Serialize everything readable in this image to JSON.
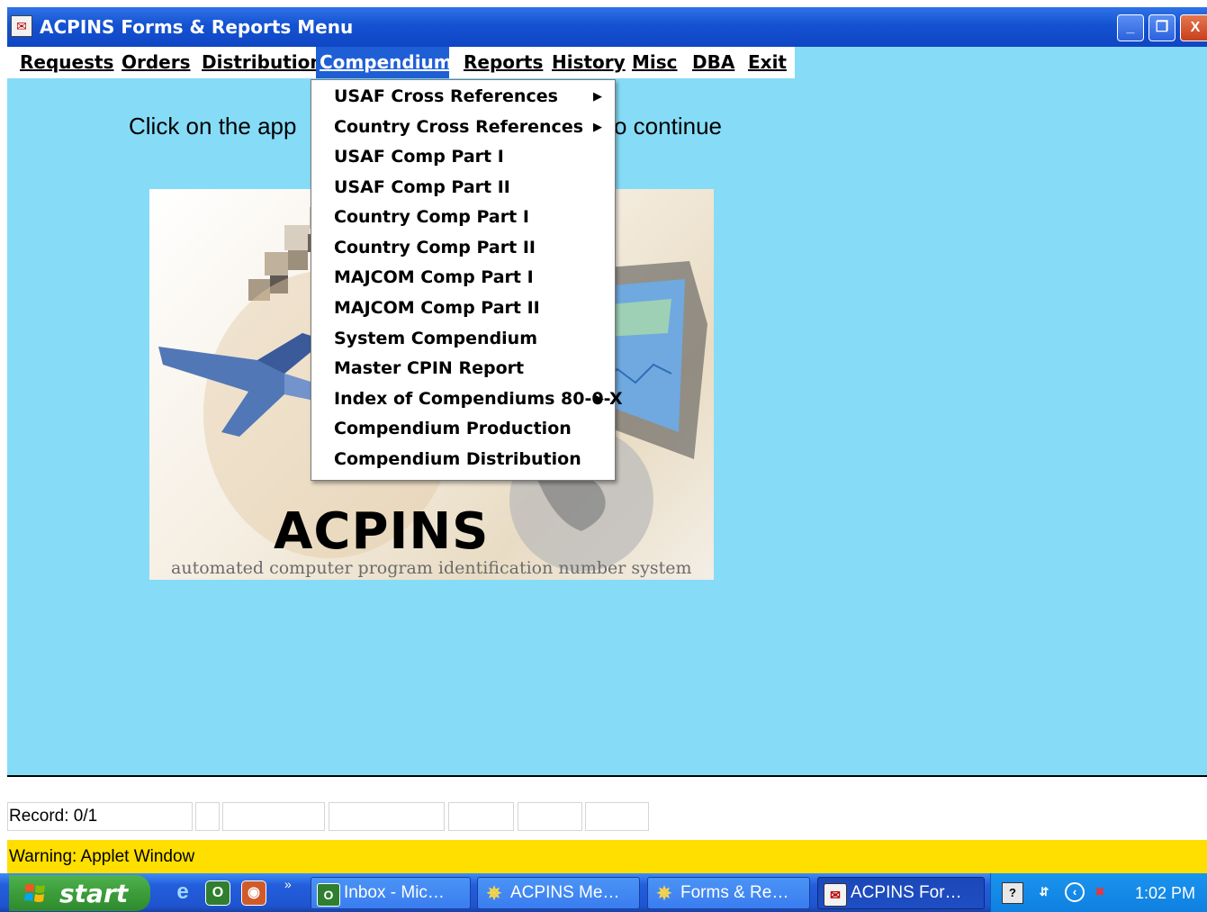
{
  "window": {
    "title": "ACPINS Forms & Reports Menu",
    "controls": {
      "minimize": "_",
      "maximize": "❐",
      "close": "X"
    }
  },
  "menubar": {
    "items": [
      {
        "label": "Requests"
      },
      {
        "label": "Orders"
      },
      {
        "label": "Distribution"
      },
      {
        "label": "Compendiums",
        "active": true
      },
      {
        "label": "Reports"
      },
      {
        "label": "History"
      },
      {
        "label": "Misc"
      },
      {
        "label": "DBA"
      },
      {
        "label": "Exit"
      }
    ]
  },
  "main": {
    "instruction_visible_left": "Click on the app",
    "instruction_visible_right": "o continue"
  },
  "splash": {
    "logo_word": "ACPINS",
    "tagline": "automated computer program identification number system"
  },
  "dropdown": {
    "items": [
      {
        "label": "USAF Cross References",
        "submenu": true
      },
      {
        "label": "Country Cross References",
        "submenu": true
      },
      {
        "label": "USAF Comp Part I"
      },
      {
        "label": "USAF Comp Part II"
      },
      {
        "label": "Country Comp Part I"
      },
      {
        "label": "Country Comp Part II"
      },
      {
        "label": "MAJCOM Comp Part I"
      },
      {
        "label": "MAJCOM Comp Part II"
      },
      {
        "label": "System Compendium"
      },
      {
        "label": "Master CPIN Report"
      },
      {
        "label": "Index of Compendiums 80-0-X",
        "submenu": true
      },
      {
        "label": "Compendium Production"
      },
      {
        "label": "Compendium Distribution"
      }
    ],
    "submenu_arrow": "▶"
  },
  "statusbar": {
    "record": "Record: 0/1",
    "warning": "Warning: Applet Window"
  },
  "taskbar": {
    "start_label": "start",
    "overflow": "»",
    "tasks": [
      {
        "label": "Inbox - Mic…",
        "icon": "outlook-icon"
      },
      {
        "label": "ACPINS Me…",
        "icon": "applet-icon"
      },
      {
        "label": "Forms & Re…",
        "icon": "applet-icon"
      },
      {
        "label": "ACPINS For…",
        "icon": "app-icon",
        "active": true
      }
    ],
    "clock": "1:02 PM"
  },
  "colors": {
    "background": "#86dcf7",
    "menu_active": "#1f5fd6",
    "warning_bar": "#ffdf00",
    "titlebar": "#1452d1"
  }
}
